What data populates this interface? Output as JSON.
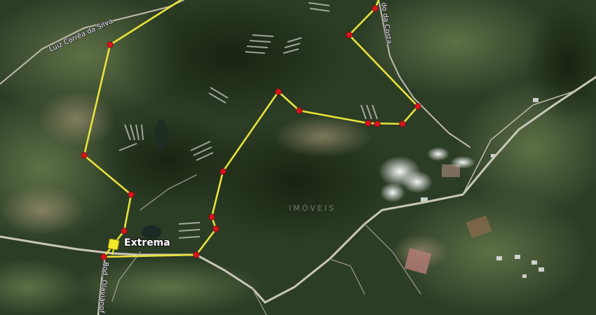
{
  "map": {
    "type": "satellite",
    "place_label": "Extrema",
    "road_labels": {
      "north_west": "Luiz Corrêa da Silva",
      "north_east": "do da Costa",
      "south": "Rod. Olavianof"
    },
    "watermark": "IMÓVEIS",
    "colors": {
      "route_line": "#e8e23a",
      "vertex": "#d8141c",
      "pin": "#f2ea2a",
      "road": "#c9c7b8"
    },
    "icons": [
      "map-pin-icon"
    ]
  }
}
